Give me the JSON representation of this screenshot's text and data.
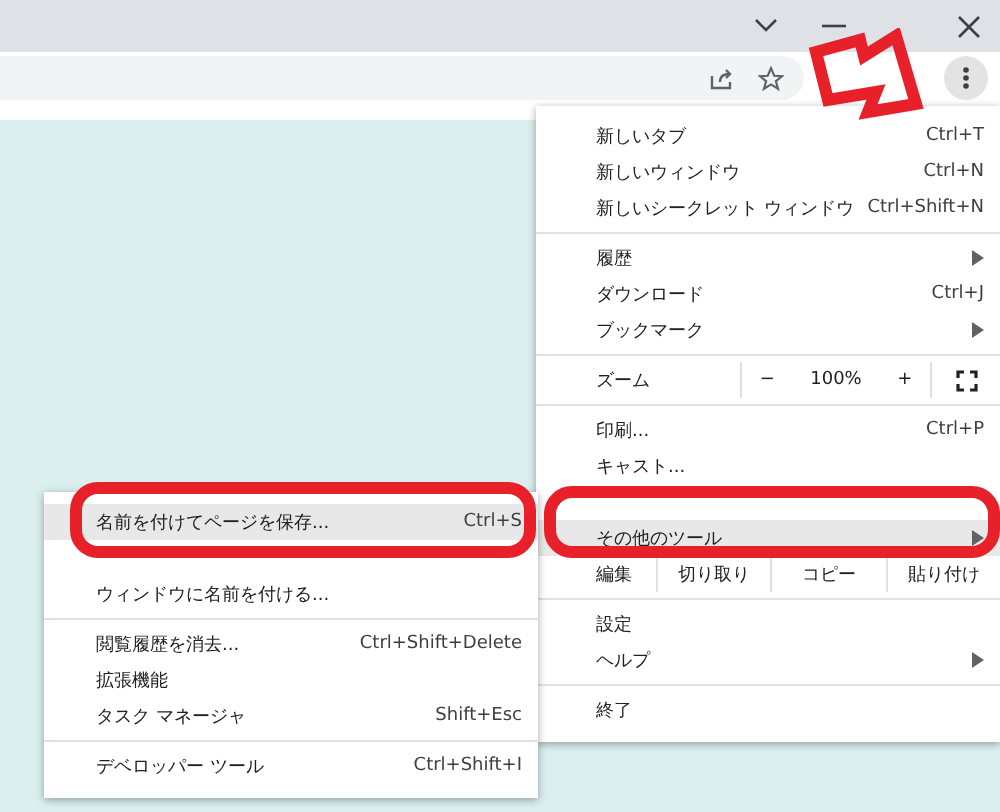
{
  "menu": {
    "sections": [
      {
        "items": [
          {
            "kind": "item",
            "label": "新しいタブ",
            "shortcut": "Ctrl+T",
            "submenu": false,
            "highlighted": false
          },
          {
            "kind": "item",
            "label": "新しいウィンドウ",
            "shortcut": "Ctrl+N",
            "submenu": false,
            "highlighted": false
          },
          {
            "kind": "item",
            "label": "新しいシークレット ウィンドウ",
            "shortcut": "Ctrl+Shift+N",
            "submenu": false,
            "highlighted": false
          }
        ]
      },
      {
        "items": [
          {
            "kind": "item",
            "label": "履歴",
            "submenu": true,
            "highlighted": false
          },
          {
            "kind": "item",
            "label": "ダウンロード",
            "shortcut": "Ctrl+J",
            "submenu": false,
            "highlighted": false
          },
          {
            "kind": "item",
            "label": "ブックマーク",
            "submenu": true,
            "highlighted": false
          }
        ]
      },
      {
        "items": [
          {
            "kind": "zoom",
            "label": "ズーム",
            "minus": "−",
            "value": "100%",
            "plus": "+"
          }
        ]
      },
      {
        "items": [
          {
            "kind": "item",
            "label": "印刷...",
            "shortcut": "Ctrl+P",
            "submenu": false,
            "highlighted": false
          },
          {
            "kind": "item",
            "label": "キャスト...",
            "submenu": false,
            "highlighted": false
          },
          {
            "kind": "obscured"
          },
          {
            "kind": "item",
            "label": "その他のツール",
            "submenu": true,
            "highlighted": true
          },
          {
            "kind": "edit",
            "label": "編集",
            "cut": "切り取り",
            "copy": "コピー",
            "paste": "貼り付け"
          }
        ]
      },
      {
        "items": [
          {
            "kind": "item",
            "label": "設定",
            "submenu": false,
            "highlighted": false
          },
          {
            "kind": "item",
            "label": "ヘルプ",
            "submenu": true,
            "highlighted": false
          }
        ]
      },
      {
        "items": [
          {
            "kind": "item",
            "label": "終了",
            "submenu": false,
            "highlighted": false
          }
        ]
      }
    ]
  },
  "submenu": {
    "sections": [
      {
        "items": [
          {
            "kind": "item",
            "label": "名前を付けてページを保存...",
            "shortcut": "Ctrl+S",
            "submenu": false,
            "highlighted": true
          },
          {
            "kind": "obscured"
          },
          {
            "kind": "item",
            "label": "ウィンドウに名前を付ける...",
            "submenu": false,
            "highlighted": false
          }
        ]
      },
      {
        "items": [
          {
            "kind": "item",
            "label": "閲覧履歴を消去...",
            "shortcut": "Ctrl+Shift+Delete",
            "submenu": false,
            "highlighted": false
          },
          {
            "kind": "item",
            "label": "拡張機能",
            "submenu": false,
            "highlighted": false
          },
          {
            "kind": "item",
            "label": "タスク マネージャ",
            "shortcut": "Shift+Esc",
            "submenu": false,
            "highlighted": false
          }
        ]
      },
      {
        "items": [
          {
            "kind": "item",
            "label": "デベロッパー ツール",
            "shortcut": "Ctrl+Shift+I",
            "submenu": false,
            "highlighted": false
          }
        ]
      }
    ]
  }
}
